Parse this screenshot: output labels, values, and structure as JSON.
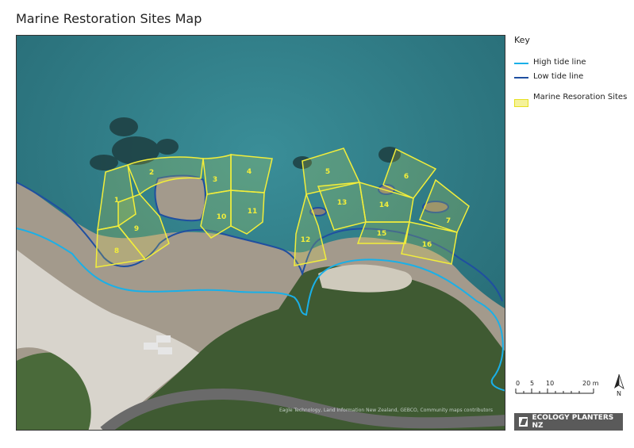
{
  "title": "Marine Restoration Sites Map",
  "key": {
    "title": "Key",
    "items": [
      {
        "label": "High tide line",
        "color": "#1ab0e8",
        "kind": "line"
      },
      {
        "label": "Low tide line",
        "color": "#1f4fa0",
        "kind": "line"
      },
      {
        "label": "Marine Resoration Sites",
        "color": "#f2ee3a",
        "kind": "polygon"
      }
    ]
  },
  "sites": [
    "1",
    "2",
    "3",
    "4",
    "5",
    "6",
    "7",
    "8",
    "9",
    "10",
    "11",
    "12",
    "13",
    "14",
    "15",
    "16"
  ],
  "scale": {
    "labels": [
      "0",
      "5",
      "10",
      "20 m"
    ]
  },
  "north_label": "N",
  "attribution": "Eagle Technology, Land Information New Zealand, GEBCO, Community maps contributors",
  "logo": "ECOLOGY PLANTERS NZ",
  "colors": {
    "sea": "#2f7f8c",
    "rock": "#a39a8c",
    "vegetation": "#3f5a32",
    "sand": "#d8d4cc",
    "site_outline": "#f2ee3a"
  }
}
